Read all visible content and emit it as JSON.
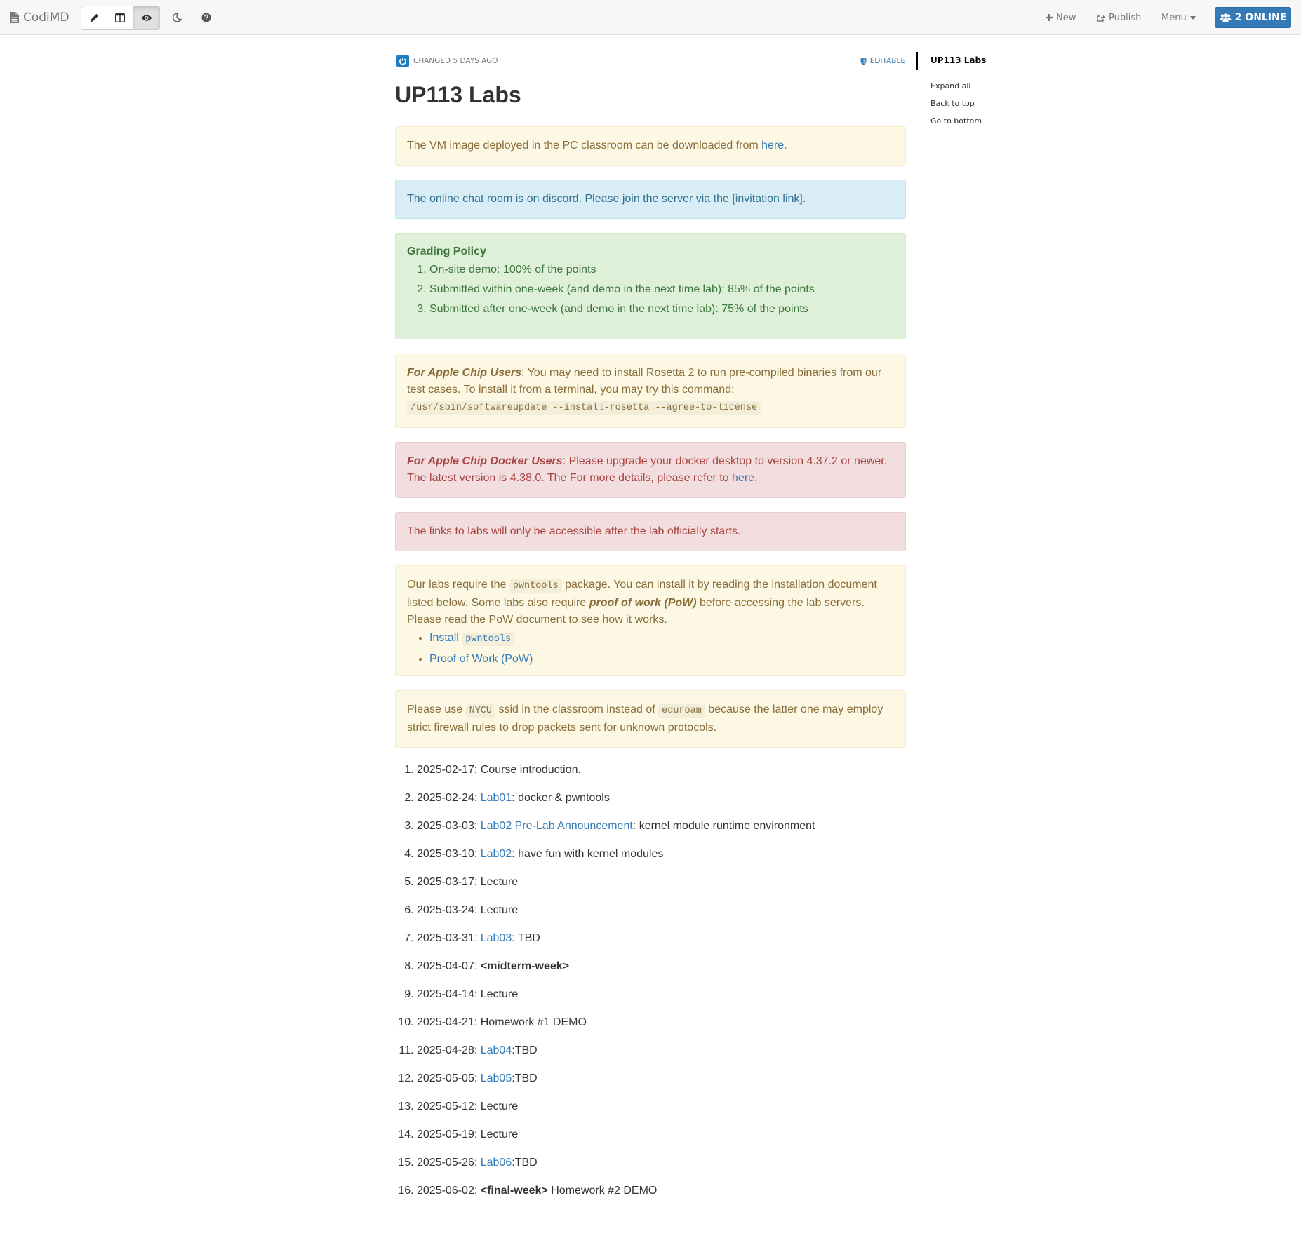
{
  "navbar": {
    "brand": "CodiMD",
    "new_label": "New",
    "publish_label": "Publish",
    "menu_label": "Menu",
    "online_label": "2 ONLINE"
  },
  "meta": {
    "changed": "CHANGED 5 DAYS AGO",
    "editable": "EDITABLE"
  },
  "title": "UP113 Labs",
  "alerts": {
    "vm": {
      "text": "The VM image deployed in the PC classroom can be downloaded from ",
      "link": "here",
      "end": "."
    },
    "discord": {
      "text": "The online chat room is on discord. Please join the server via the [invitation link]."
    },
    "grading": {
      "heading": "Grading Policy",
      "items": [
        "On-site demo: 100% of the points",
        "Submitted within one-week (and demo in the next time lab): 85% of the points",
        "Submitted after one-week (and demo in the next time lab): 75% of the points"
      ]
    },
    "apple": {
      "strong": "For Apple Chip Users",
      "text": ": You may need to install Rosetta 2 to run pre-compiled binaries from our test cases. To install it from a terminal, you may try this command:",
      "code": "/usr/sbin/softwareupdate --install-rosetta --agree-to-license"
    },
    "docker": {
      "strong": "For Apple Chip Docker Users",
      "text": ": Please upgrade your docker desktop to version 4.37.2 or newer. The latest version is 4.38.0. The For more details, please refer to ",
      "link": "here",
      "end": "."
    },
    "links": {
      "text": "The links to labs will only be accessible after the lab officially starts."
    },
    "pwntools": {
      "t1": "Our labs require the ",
      "code": "pwntools",
      "t2": " package. You can install it by reading the installation document listed below. Some labs also require ",
      "strong": "proof of work (PoW)",
      "t3": " before accessing the lab servers. Please read the PoW document to see how it works.",
      "install_link": "Install",
      "install_code": "pwntools",
      "pow_link": "Proof of Work (PoW)"
    },
    "nycu": {
      "t1": "Please use ",
      "code1": "NYCU",
      "t2": " ssid in the classroom instead of ",
      "code2": "eduroam",
      "t3": " because the latter one may employ strict firewall rules to drop packets sent for unknown protocols."
    }
  },
  "schedule": [
    {
      "date": "2025-02-17: ",
      "link": "",
      "bold": "",
      "text": "Course introduction."
    },
    {
      "date": "2025-02-24: ",
      "link": "Lab01",
      "bold": "",
      "text": ": docker & pwntools"
    },
    {
      "date": "2025-03-03: ",
      "link": "Lab02 Pre-Lab Announcement",
      "bold": "",
      "text": ": kernel module runtime environment"
    },
    {
      "date": "2025-03-10: ",
      "link": "Lab02",
      "bold": "",
      "text": ": have fun with kernel modules"
    },
    {
      "date": "2025-03-17: ",
      "link": "",
      "bold": "",
      "text": "Lecture"
    },
    {
      "date": "2025-03-24: ",
      "link": "",
      "bold": "",
      "text": "Lecture"
    },
    {
      "date": "2025-03-31: ",
      "link": "Lab03",
      "bold": "",
      "text": ": TBD"
    },
    {
      "date": "2025-04-07: ",
      "link": "",
      "bold": "<midterm-week>",
      "text": ""
    },
    {
      "date": "2025-04-14: ",
      "link": "",
      "bold": "",
      "text": "Lecture"
    },
    {
      "date": "2025-04-21: ",
      "link": "",
      "bold": "",
      "text": "Homework #1 DEMO"
    },
    {
      "date": "2025-04-28: ",
      "link": "Lab04",
      "bold": "",
      "text": ":TBD"
    },
    {
      "date": "2025-05-05: ",
      "link": "Lab05",
      "bold": "",
      "text": ":TBD"
    },
    {
      "date": "2025-05-12: ",
      "link": "",
      "bold": "",
      "text": "Lecture"
    },
    {
      "date": "2025-05-19: ",
      "link": "",
      "bold": "",
      "text": "Lecture"
    },
    {
      "date": "2025-05-26: ",
      "link": "Lab06",
      "bold": "",
      "text": ":TBD"
    },
    {
      "date": "2025-06-02: ",
      "link": "",
      "bold": "<final-week>",
      "text": " Homework #2 DEMO"
    }
  ],
  "toc": {
    "title": "UP113 Labs",
    "expand_all": "Expand all",
    "back_to_top": "Back to top",
    "go_to_bottom": "Go to bottom"
  },
  "colors": {
    "link": "#337ab7",
    "online_button": "#337ab7",
    "warning_bg": "#fcf8e3",
    "info_bg": "#d9edf7",
    "success_bg": "#dff0d8",
    "danger_bg": "#f2dede"
  },
  "icons": {
    "brand": "file-text-icon",
    "edit": "pencil-icon",
    "split": "columns-icon",
    "view": "eye-icon",
    "night": "moon-icon",
    "help": "question-circle-icon",
    "new": "plus-icon",
    "publish": "share-square-icon",
    "menu": "caret-down-icon",
    "online": "users-icon",
    "avatar": "power-icon",
    "editable": "shield-icon"
  }
}
